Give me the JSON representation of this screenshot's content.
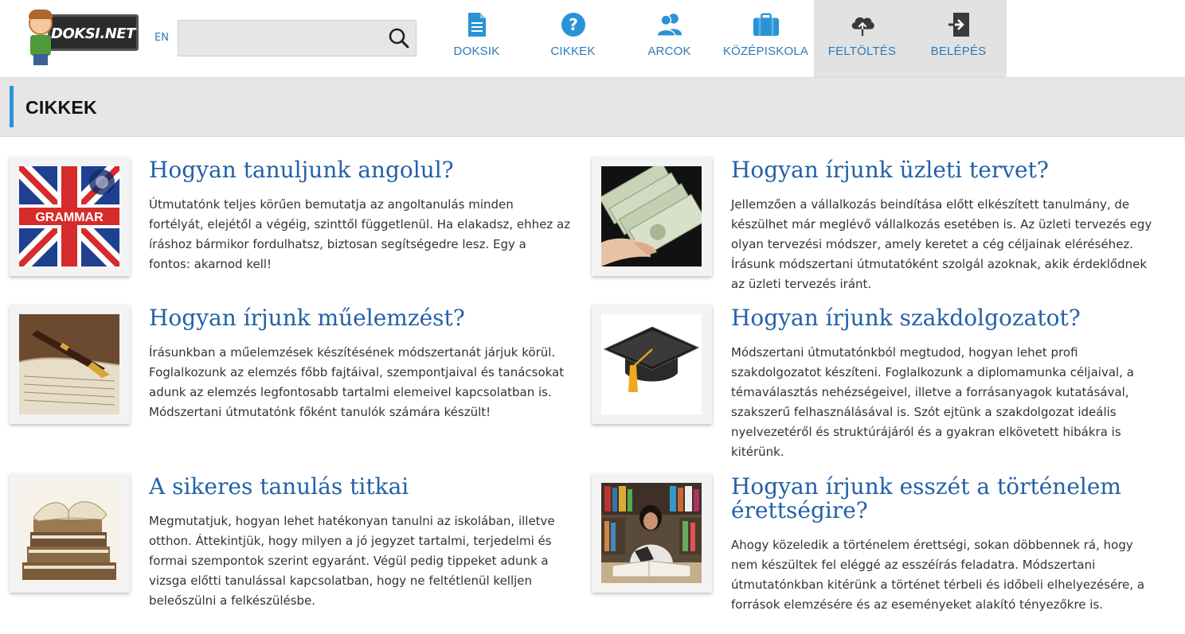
{
  "header": {
    "logo_text": "DOKSI.NET",
    "lang": "EN",
    "search": {
      "value": "",
      "placeholder": ""
    },
    "nav": [
      {
        "label": "DOKSIK",
        "icon": "document-icon"
      },
      {
        "label": "CIKKEK",
        "icon": "question-icon"
      },
      {
        "label": "ARCOK",
        "icon": "people-icon"
      },
      {
        "label": "KÖZÉPISKOLA",
        "icon": "briefcase-icon"
      },
      {
        "label": "FELTÖLTÉS",
        "icon": "cloud-upload-icon"
      },
      {
        "label": "BELÉPÉS",
        "icon": "login-icon"
      }
    ]
  },
  "section": {
    "title": "CIKKEK"
  },
  "articles": [
    {
      "title": "Hogyan tanuljunk angolul?",
      "text": "Útmutatónk teljes körűen bemutatja az angoltanulás minden fortélyát, elejétől a végéig, szinttől függetlenül. Ha elakadsz, ehhez az íráshoz bármikor fordulhatsz, biztosan segítségedre lesz. Egy a fontos: akarnod kell!",
      "image": "grammar-flag-image",
      "image_text": "GRAMMAR"
    },
    {
      "title": "Hogyan írjunk üzleti tervet?",
      "text": "Jellemzően a vállalkozás beindítása előtt elkészített tanulmány, de készülhet már meglévő vállalkozás esetében is. Az üzleti tervezés egy olyan tervezési módszer, amely keretet a cég céljainak eléréséhez. Írásunk módszertani útmutatóként szolgál azoknak, akik érdeklődnek az üzleti tervezés iránt.",
      "image": "money-image"
    },
    {
      "title": "Hogyan írjunk műelemzést?",
      "text": "Írásunkban a műelemzések készítésének módszertanát járjuk körül. Foglalkozunk az elemzés főbb fajtáival, szempontjaival és tanácsokat adunk az elemzés legfontosabb tartalmi elemeivel kapcsolatban is. Módszertani útmutatónk főként tanulók számára készült!",
      "image": "pen-on-book-image"
    },
    {
      "title": "Hogyan írjunk szakdolgozatot?",
      "text": "Módszertani útmutatónkból megtudod, hogyan lehet profi szakdolgozatot készíteni. Foglalkozunk a diplomamunka céljaival, a témaválasztás nehézségeivel, illetve a forrásanyagok kutatásával, szakszerű felhasználásával is. Szót ejtünk a szakdolgozat ideális nyelvezetéről és struktúrájáról és a gyakran elkövetett hibákra is kitérünk.",
      "image": "graduation-cap-image"
    },
    {
      "title": "A sikeres tanulás titkai",
      "text": "Megmutatjuk, hogyan lehet hatékonyan tanulni az iskolában, illetve otthon. Áttekintjük, hogy milyen a jó jegyzet tartalmi, terjedelmi és formai szempontok szerint egyaránt. Végül pedig tippeket adunk a vizsga előtti tanulással kapcsolatban, hogy ne feltétlenül kelljen beleőszülni a felkészülésbe.",
      "image": "book-stack-image"
    },
    {
      "title": "Hogyan írjunk esszét a történelem érettségire?",
      "text": "Ahogy közeledik a történelem érettségi, sokan döbbennek rá, hogy nem készültek fel eléggé az esszéírás feladatra. Módszertani útmutatónkban kitérünk a történet térbeli és időbeli elhelyezésére, a források elemzésére és az eseményeket alakító tényezőkre is.",
      "image": "student-library-image"
    }
  ],
  "colors": {
    "accent": "#2a93d5",
    "link": "#2361a8",
    "nav_text": "#2a7ab8",
    "active_nav_bg": "#e2e2e2"
  }
}
